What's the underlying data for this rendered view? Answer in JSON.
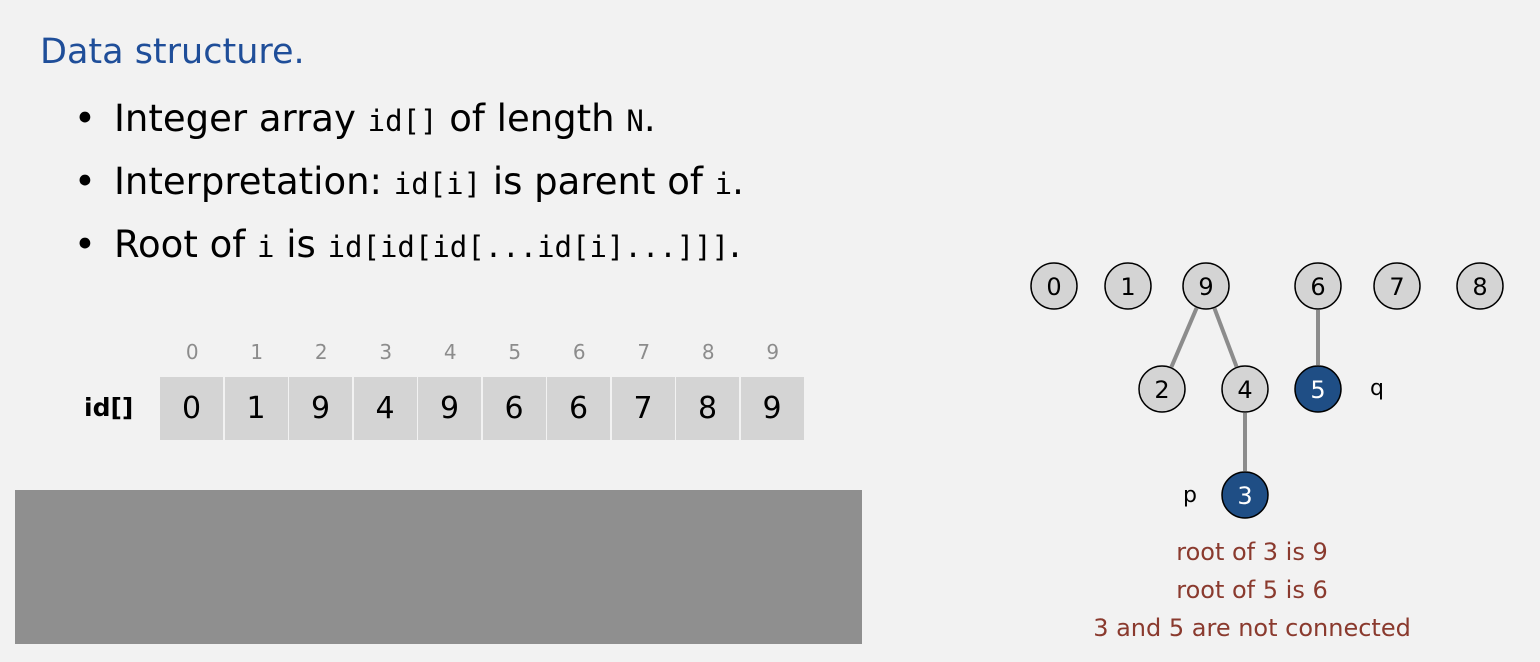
{
  "heading": "Data structure.",
  "bullets": {
    "b1": {
      "t1": "Integer array ",
      "c1": "id[]",
      "t2": " of length ",
      "c2": "N",
      "t3": "."
    },
    "b2": {
      "t1": "Interpretation:  ",
      "c1": "id[i]",
      "t2": " is parent of ",
      "c2": "i",
      "t3": "."
    },
    "b3": {
      "t1": "Root of ",
      "c1": "i",
      "t2": " is ",
      "c2": "id[id[id[...id[i]...]]]",
      "t3": "."
    }
  },
  "array": {
    "label": "id[]",
    "indices": [
      "0",
      "1",
      "2",
      "3",
      "4",
      "5",
      "6",
      "7",
      "8",
      "9"
    ],
    "values": [
      "0",
      "1",
      "9",
      "4",
      "9",
      "6",
      "6",
      "7",
      "8",
      "9"
    ]
  },
  "forest": {
    "nodes": [
      {
        "label": "0",
        "highlight": false
      },
      {
        "label": "1",
        "highlight": false
      },
      {
        "label": "9",
        "highlight": false
      },
      {
        "label": "6",
        "highlight": false
      },
      {
        "label": "7",
        "highlight": false
      },
      {
        "label": "8",
        "highlight": false
      },
      {
        "label": "2",
        "highlight": false
      },
      {
        "label": "4",
        "highlight": false
      },
      {
        "label": "5",
        "highlight": true
      },
      {
        "label": "3",
        "highlight": true
      }
    ],
    "edges": [
      [
        "9",
        "2"
      ],
      [
        "9",
        "4"
      ],
      [
        "6",
        "5"
      ],
      [
        "4",
        "3"
      ]
    ],
    "label_p": "p",
    "label_q": "q",
    "node_fill": "#d4d4d4",
    "highlight_fill": "#1f4e85"
  },
  "captions": [
    "root of 3 is 9",
    "root of 5 is 6",
    "3 and 5 are not connected"
  ]
}
